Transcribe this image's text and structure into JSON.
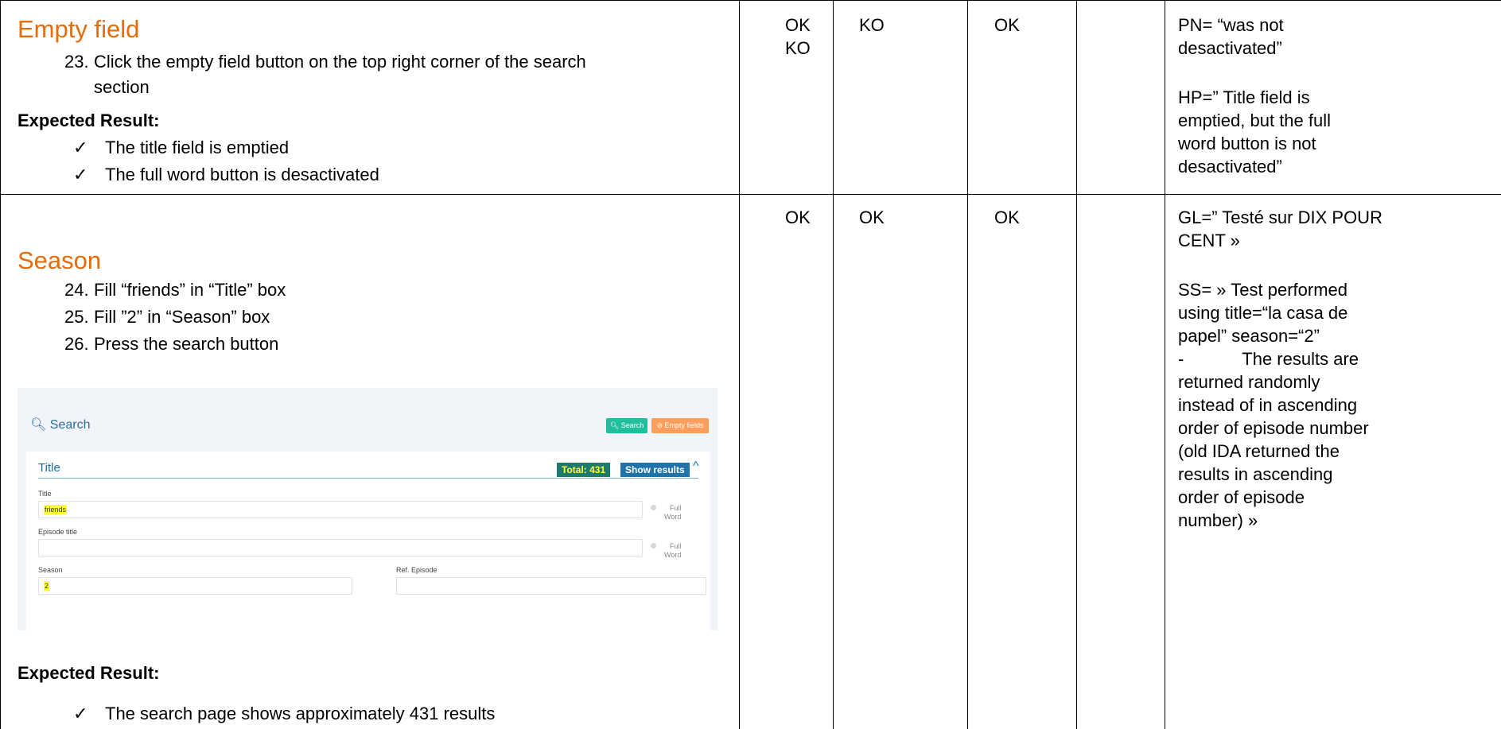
{
  "row1": {
    "title": "Empty field",
    "steps": [
      {
        "num": "23.",
        "text": "Click the empty field button on the top right corner of the search",
        "cont": "section"
      }
    ],
    "expected_label": "Expected Result:",
    "expected": [
      "The title field is emptied",
      "The full word button is desactivated"
    ],
    "status": [
      "OK\nKO",
      "KO",
      "OK",
      ""
    ],
    "comment": [
      "PN= “was not",
      "desactivated”",
      "",
      "HP=” Title field is",
      "emptied, but the full",
      "word button is not",
      "desactivated”"
    ]
  },
  "row2": {
    "title": "Season",
    "steps": [
      {
        "num": "24.",
        "text": "Fill “friends” in “Title” box"
      },
      {
        "num": "25.",
        "text": "Fill ”2” in “Season” box"
      },
      {
        "num": "26.",
        "text": "Press the search button"
      }
    ],
    "expected_label": "Expected Result:",
    "expected": [
      "The search page shows approximately 431 results"
    ],
    "status": [
      "OK",
      "OK",
      "OK",
      ""
    ],
    "comment": [
      "GL=” Testé sur DIX POUR",
      "CENT »",
      "",
      "SS= » Test performed",
      "using title=“la casa de",
      "papel” season=“2”",
      "-            The results are",
      "returned randomly",
      "instead of in ascending",
      "order of episode number",
      "(old IDA returned the",
      "results in ascending",
      "order of episode",
      "number) »"
    ]
  },
  "screenshot": {
    "search_title": "Search",
    "search_btn": "Search",
    "empty_btn": "Empty fields",
    "panel_title": "Title",
    "total_badge": "Total: 431",
    "show_results": "Show results",
    "title_label": "Title",
    "title_value": "friends",
    "full_word": "Full\nWord",
    "episode_title_label": "Episode title",
    "season_label": "Season",
    "season_value": "2",
    "ref_episode_label": "Ref. Episode"
  },
  "icons": {
    "check": "check-mark-icon",
    "search": "search-icon",
    "ban": "ban-icon",
    "chevron": "chevron-up-icon"
  },
  "colors": {
    "section_title": "#e46c0a",
    "search_button": "#1fbf9e",
    "empty_button": "#ff9e5a",
    "total_badge": "#1e7a6e",
    "highlight": "#ffff3a"
  }
}
